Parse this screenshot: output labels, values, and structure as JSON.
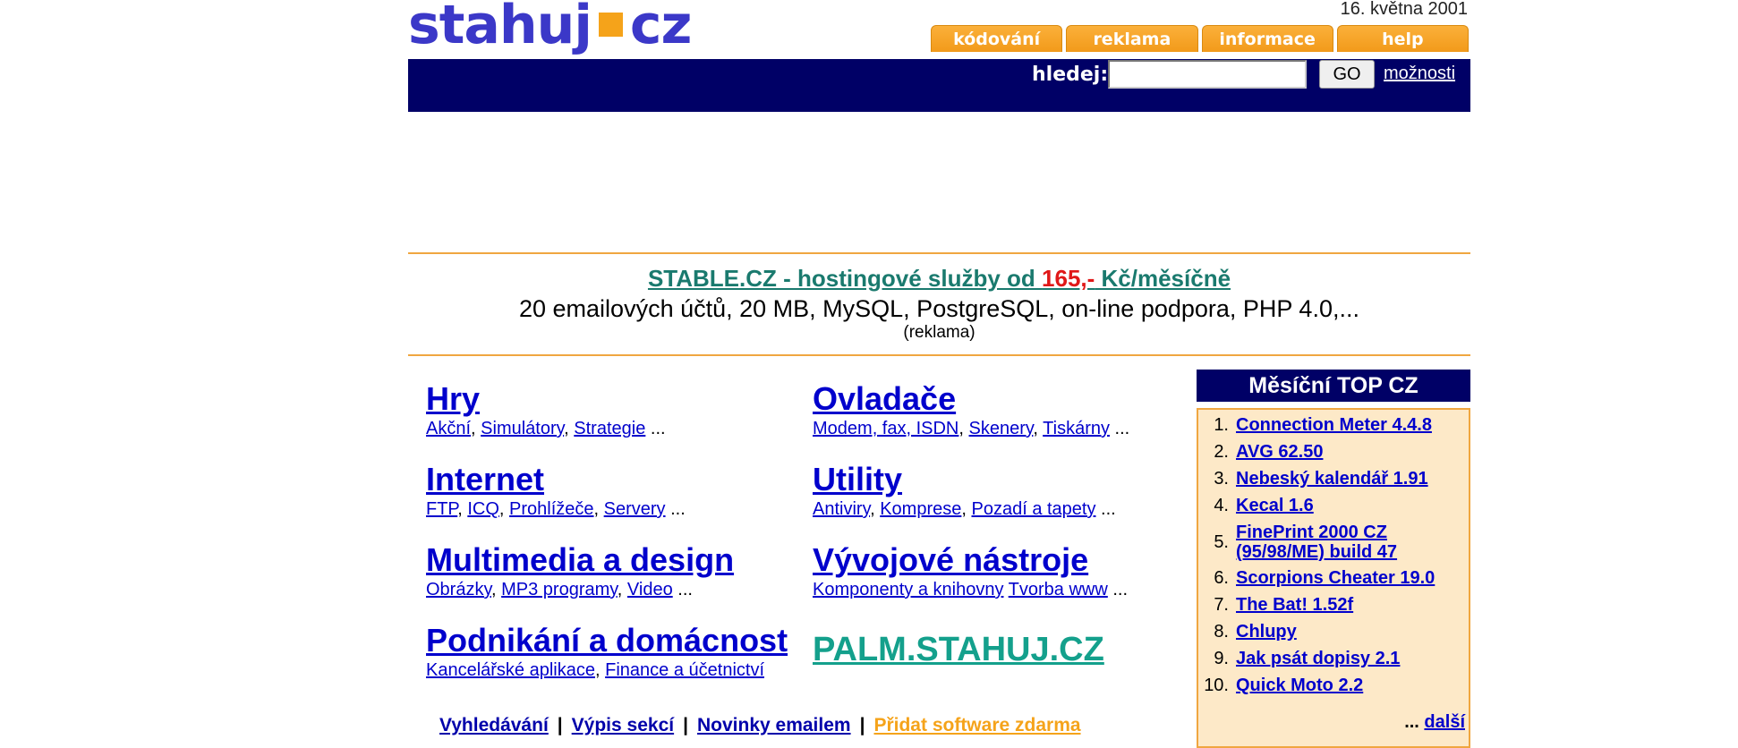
{
  "header": {
    "logo_left": "stahuj",
    "logo_right": "cz",
    "date": "16. května 2001",
    "tabs": [
      "kódování",
      "reklama",
      "informace",
      "help"
    ]
  },
  "search": {
    "label": "hledej:",
    "value": "",
    "go_label": "GO",
    "options_label": "možnosti"
  },
  "ad": {
    "title_pre": "STABLE.CZ - hostingové služby od ",
    "title_price": "165,-",
    "title_post": " Kč/měsíčně",
    "line": "20 emailových účtů, 20 MB, MySQL, PostgreSQL, on-line podpora, PHP 4.0,...",
    "note": "(reklama)"
  },
  "categories": [
    {
      "title": "Hry",
      "links": [
        "Akční",
        "Simulátory",
        "Strategie"
      ],
      "tail": " ..."
    },
    {
      "title": "Ovladače",
      "links": [
        "Modem, fax, ISDN",
        "Skenery",
        "Tiskárny"
      ],
      "tail": " ..."
    },
    {
      "title": "Internet",
      "links": [
        "FTP",
        "ICQ",
        "Prohlížeče",
        "Servery"
      ],
      "tail": " ..."
    },
    {
      "title": "Utility",
      "links": [
        "Antiviry",
        "Komprese",
        "Pozadí a tapety"
      ],
      "tail": " ..."
    },
    {
      "title": "Multimedia a design",
      "links": [
        "Obrázky",
        "MP3 programy",
        "Video"
      ],
      "tail": " ..."
    },
    {
      "title": "Vývojové nástroje",
      "links": [
        "Komponenty a knihovny",
        "Tvorba www"
      ],
      "tail": " ..."
    },
    {
      "title": "Podnikání a domácnost",
      "links": [
        "Kancelářské aplikace",
        "Finance a účetnictví"
      ],
      "tail": ""
    }
  ],
  "palm_link": "PALM.STAHUJ.CZ",
  "footer": {
    "links": [
      "Vyhledávání",
      "Výpis sekcí",
      "Novinky emailem"
    ],
    "highlight": "Přidat software zdarma"
  },
  "top": {
    "title": "Měsíční TOP CZ",
    "items": [
      {
        "num": "1.",
        "name": "Connection Meter 4.4.8"
      },
      {
        "num": "2.",
        "name": "AVG 62.50"
      },
      {
        "num": "3.",
        "name": "Nebeský kalendář 1.91"
      },
      {
        "num": "4.",
        "name": "Kecal 1.6"
      },
      {
        "num": "5.",
        "name": "FinePrint 2000 CZ (95/98/ME) build 47"
      },
      {
        "num": "6.",
        "name": "Scorpions Cheater 19.0"
      },
      {
        "num": "7.",
        "name": "The Bat! 1.52f"
      },
      {
        "num": "8.",
        "name": "Chlupy"
      },
      {
        "num": "9.",
        "name": "Jak psát dopisy 2.1"
      },
      {
        "num": "10.",
        "name": "Quick Moto 2.2"
      }
    ],
    "more_prefix": "...",
    "more_label": "další"
  }
}
